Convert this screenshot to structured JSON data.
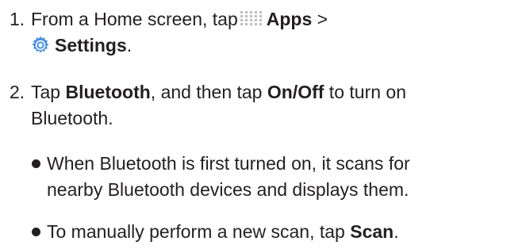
{
  "steps": [
    {
      "number": "1.",
      "line1_pre": "From a Home screen, tap",
      "apps_label": "Apps",
      "line1_post": " >",
      "settings_label": "Settings",
      "line2_post": ".",
      "icons": [
        "apps-grid-icon",
        "settings-gear-icon"
      ]
    },
    {
      "number": "2.",
      "pre": "Tap ",
      "bluetooth_label": "Bluetooth",
      "mid": ", and then tap ",
      "onoff_label": "On/Off",
      "post_line1": " to turn on",
      "line2": "Bluetooth."
    }
  ],
  "bullets": [
    {
      "line1": "When Bluetooth is first turned on, it scans for",
      "line2": "nearby Bluetooth devices and displays them."
    },
    {
      "pre": "To manually perform a new scan, tap ",
      "scan_label": "Scan",
      "post": "."
    }
  ],
  "colors": {
    "text": "#231f20",
    "apps_icon_dots": "#bdbdbd",
    "settings_icon": "#4a90d9"
  }
}
